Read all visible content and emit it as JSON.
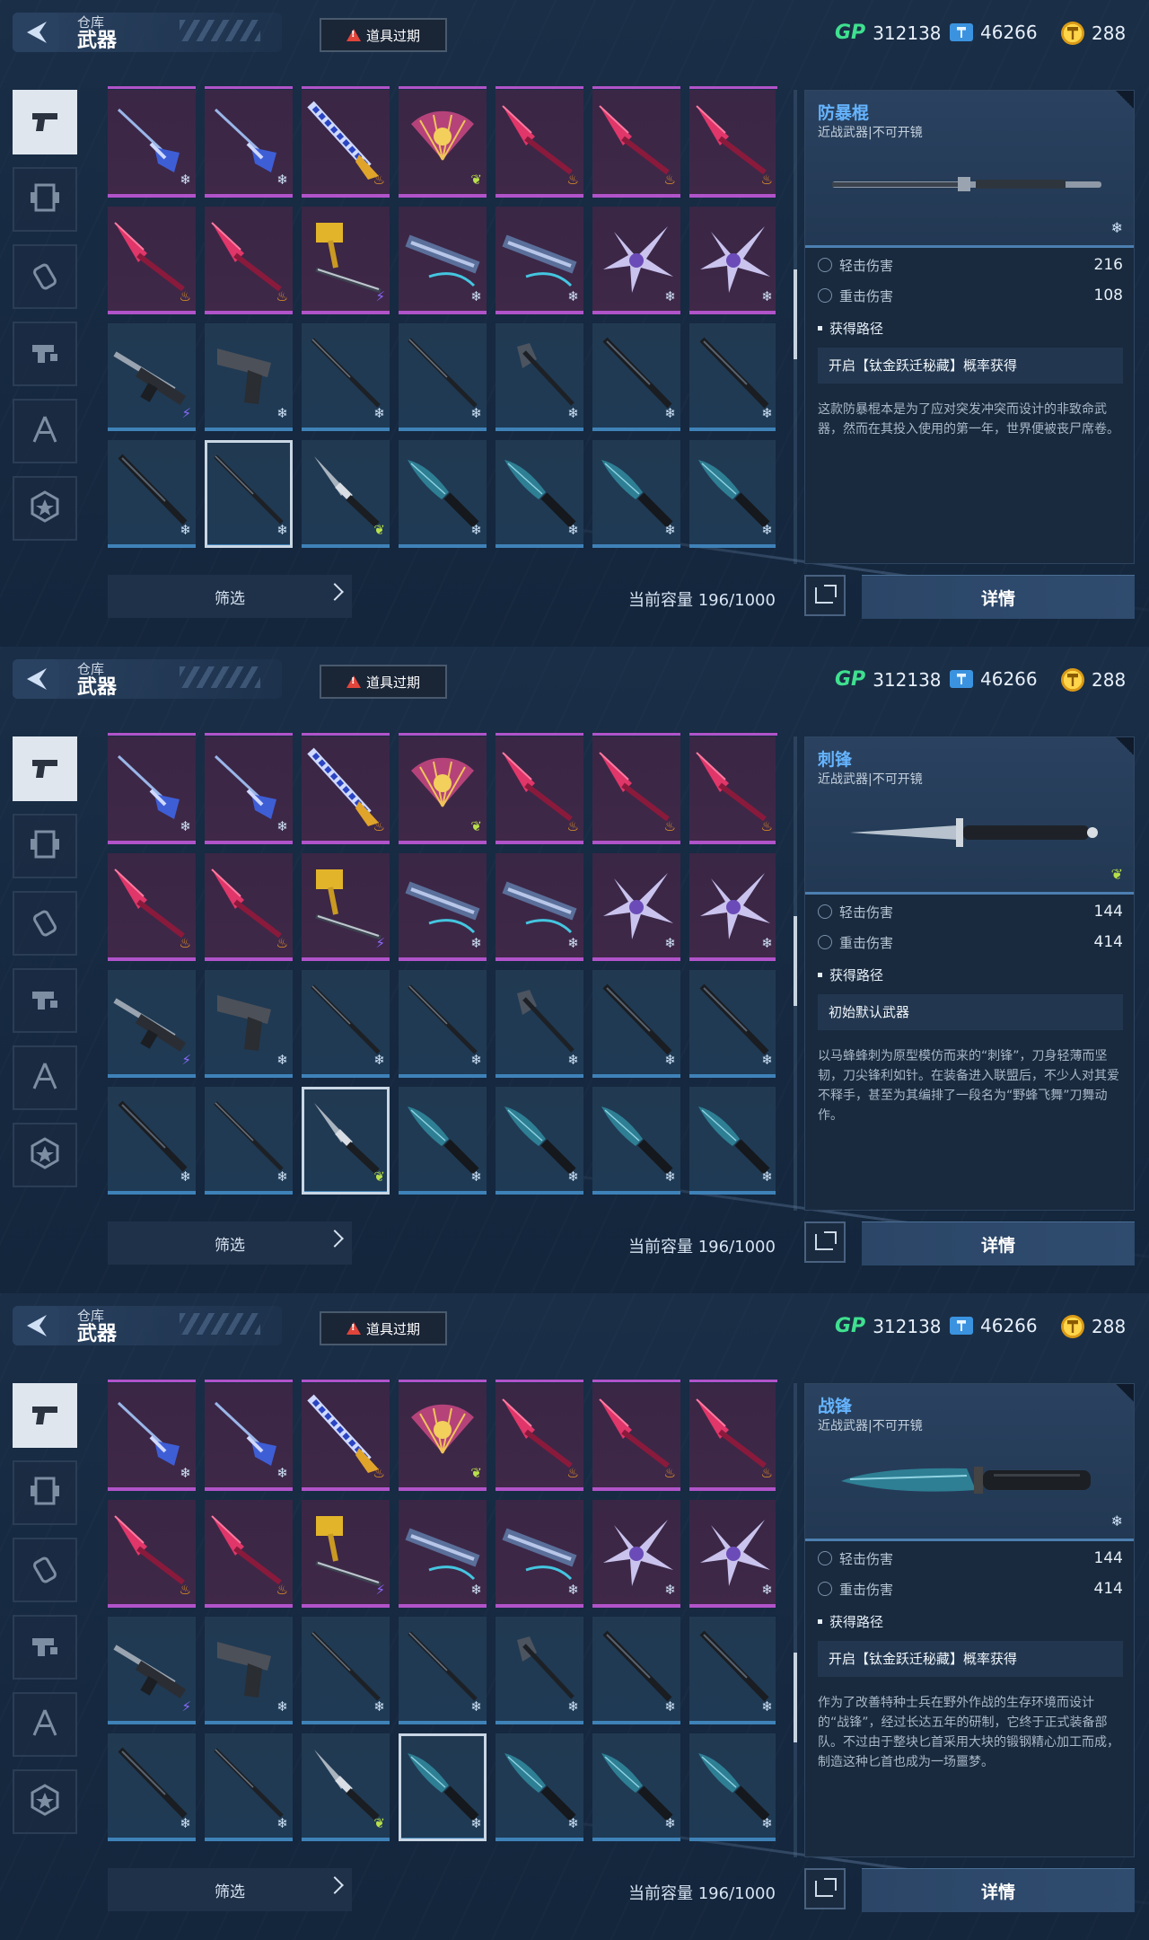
{
  "screens": [
    {
      "header": {
        "title_sub": "仓库",
        "title_main": "武器",
        "expire_label": "道具过期"
      },
      "currency": {
        "gp_label": "GP",
        "gp": "312138",
        "tickets": "46266",
        "coins": "288"
      },
      "footer": {
        "filter_label": "筛选",
        "capacity": "当前容量 196/1000",
        "detail_label": "详情"
      },
      "selected_tile": 22,
      "detail": {
        "name": "防暴棍",
        "type": "近战武器|不可开镜",
        "weapon_icon": "baton",
        "rarity_badge": "snow",
        "light_label": "轻击伤害",
        "light_value": "216",
        "heavy_label": "重击伤害",
        "heavy_value": "108",
        "source_label": "获得路径",
        "source": "开启【钛金跃迁秘藏】概率获得",
        "description": "这款防暴棍本是为了应对突发冲突而设计的非致命武器，然而在其投入使用的第一年，世界便被丧尸席卷。"
      }
    },
    {
      "header": {
        "title_sub": "仓库",
        "title_main": "武器",
        "expire_label": "道具过期"
      },
      "currency": {
        "gp_label": "GP",
        "gp": "312138",
        "tickets": "46266",
        "coins": "288"
      },
      "footer": {
        "filter_label": "筛选",
        "capacity": "当前容量 196/1000",
        "detail_label": "详情"
      },
      "selected_tile": 23,
      "detail": {
        "name": "刺锋",
        "type": "近战武器|不可开镜",
        "weapon_icon": "stiletto",
        "rarity_badge": "leaf",
        "light_label": "轻击伤害",
        "light_value": "144",
        "heavy_label": "重击伤害",
        "heavy_value": "414",
        "source_label": "获得路径",
        "source": "初始默认武器",
        "description": "以马蜂蜂刺为原型模仿而来的“刺锋”，刀身轻薄而坚韧，刀尖锋利如针。在装备进入联盟后，不少人对其爱不释手，甚至为其编排了一段名为“野蜂飞舞”刀舞动作。"
      }
    },
    {
      "header": {
        "title_sub": "仓库",
        "title_main": "武器",
        "expire_label": "道具过期"
      },
      "currency": {
        "gp_label": "GP",
        "gp": "312138",
        "tickets": "46266",
        "coins": "288"
      },
      "footer": {
        "filter_label": "筛选",
        "capacity": "当前容量 196/1000",
        "detail_label": "详情"
      },
      "selected_tile": 24,
      "detail": {
        "name": "战锋",
        "type": "近战武器|不可开镜",
        "weapon_icon": "combat-knife",
        "rarity_badge": "snow",
        "light_label": "轻击伤害",
        "light_value": "144",
        "heavy_label": "重击伤害",
        "heavy_value": "414",
        "source_label": "获得路径",
        "source": "开启【钛金跃迁秘藏】概率获得",
        "description": "作为了改善特种士兵在野外作战的生存环境而设计的“战锋”，经过长达五年的研制，它终于正式装备部队。不过由于整块匕首采用大块的锻钢精心加工而成，制造这种匕首也成为一场噩梦。"
      }
    }
  ],
  "tiles": [
    {
      "type": "spear-blue",
      "rarity": "purple",
      "badge": "snow"
    },
    {
      "type": "spear-blue",
      "rarity": "purple",
      "badge": "snow"
    },
    {
      "type": "sword-gold",
      "rarity": "purple",
      "badge": "fire"
    },
    {
      "type": "fan",
      "rarity": "purple",
      "badge": "leaf"
    },
    {
      "type": "spear-pink",
      "rarity": "purple",
      "badge": "fire"
    },
    {
      "type": "spear-pink",
      "rarity": "purple",
      "badge": "fire"
    },
    {
      "type": "spear-pink",
      "rarity": "purple",
      "badge": "fire"
    },
    {
      "type": "spear-pink",
      "rarity": "purple",
      "badge": "fire"
    },
    {
      "type": "spear-pink",
      "rarity": "purple",
      "badge": "fire"
    },
    {
      "type": "hammer-gold",
      "rarity": "purple",
      "badge": "bolt"
    },
    {
      "type": "crossbow",
      "rarity": "purple",
      "badge": "snow"
    },
    {
      "type": "crossbow",
      "rarity": "purple",
      "badge": "snow"
    },
    {
      "type": "shuriken",
      "rarity": "purple",
      "badge": "snow"
    },
    {
      "type": "shuriken",
      "rarity": "purple",
      "badge": "snow"
    },
    {
      "type": "shotgun",
      "rarity": "blue",
      "badge": "bolt"
    },
    {
      "type": "pistol",
      "rarity": "blue",
      "badge": "snow"
    },
    {
      "type": "rod",
      "rarity": "blue",
      "badge": "snow"
    },
    {
      "type": "rod",
      "rarity": "blue",
      "badge": "snow"
    },
    {
      "type": "axe",
      "rarity": "blue",
      "badge": "snow"
    },
    {
      "type": "baton",
      "rarity": "blue",
      "badge": "snow"
    },
    {
      "type": "baton",
      "rarity": "blue",
      "badge": "snow"
    },
    {
      "type": "baton",
      "rarity": "blue",
      "badge": "snow"
    },
    {
      "type": "rod",
      "rarity": "blue",
      "badge": "snow"
    },
    {
      "type": "stiletto",
      "rarity": "blue",
      "badge": "leaf"
    },
    {
      "type": "combat-knife",
      "rarity": "blue",
      "badge": "snow"
    },
    {
      "type": "combat-knife",
      "rarity": "blue",
      "badge": "snow"
    },
    {
      "type": "combat-knife",
      "rarity": "blue",
      "badge": "snow"
    },
    {
      "type": "combat-knife",
      "rarity": "blue",
      "badge": "snow"
    }
  ],
  "categories": [
    {
      "name": "pistol-icon",
      "active": true
    },
    {
      "name": "armor-icon",
      "active": false
    },
    {
      "name": "grenade-icon",
      "active": false
    },
    {
      "name": "gear-pack-icon",
      "active": false
    },
    {
      "name": "tools-icon",
      "active": false
    },
    {
      "name": "badge-star-icon",
      "active": false
    }
  ],
  "colors": {
    "accent": "#65b4ff",
    "purple_rarity": "#b153c9",
    "blue_rarity": "#3f82b8",
    "gp": "#3fe08f"
  },
  "badge_glyphs": {
    "snow": "❄",
    "fire": "♨",
    "bolt": "⚡",
    "leaf": "❦"
  }
}
